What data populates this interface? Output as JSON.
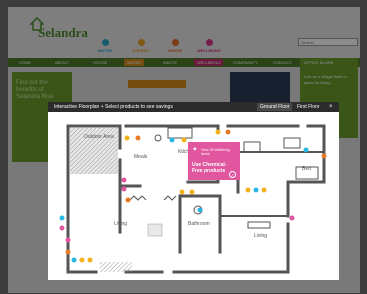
{
  "site": {
    "logo_text": "Selandra",
    "logo_sub": "",
    "search_placeholder": "Search",
    "categories": [
      {
        "label": "WATER",
        "color": "#2aa6c9"
      },
      {
        "label": "ENERGY",
        "color": "#e3a12a"
      },
      {
        "label": "WASTE",
        "color": "#e26b2a"
      },
      {
        "label": "WELLBEING",
        "color": "#d3378a"
      }
    ],
    "nav": [
      "HOME",
      "ABOUT",
      "HOUSE",
      "WATER",
      "WASTE",
      "WELLBEING",
      "COMMUNITY",
      "CONTACT"
    ],
    "left_blurb": "Find out the benefits of Selandra Rise",
    "right_panel_title": "OFFICE BLURB",
    "right_panel_text": "Live on a village that's a place for living..."
  },
  "modal": {
    "title": "Interactive Floorplan + Select products to see savings",
    "ground_floor": "Ground Floor",
    "first_floor": "First Floor",
    "close": "×"
  },
  "rooms": {
    "outdoor": "Outdoor Area",
    "meals": "Meals",
    "kitchen": "Kitchen",
    "bed": "Bed",
    "living1": "Living",
    "bathroom": "Bathroom",
    "living2": "Living"
  },
  "popup": {
    "small": "View 25 Wellbeing Items",
    "main": "Use Chemical-Free products",
    "arrow": "›"
  },
  "hotspot_colors": {
    "water": "#2ab6e0",
    "energy": "#f2b21a",
    "wellbeing": "#e0569f",
    "waste": "#e67a25"
  }
}
